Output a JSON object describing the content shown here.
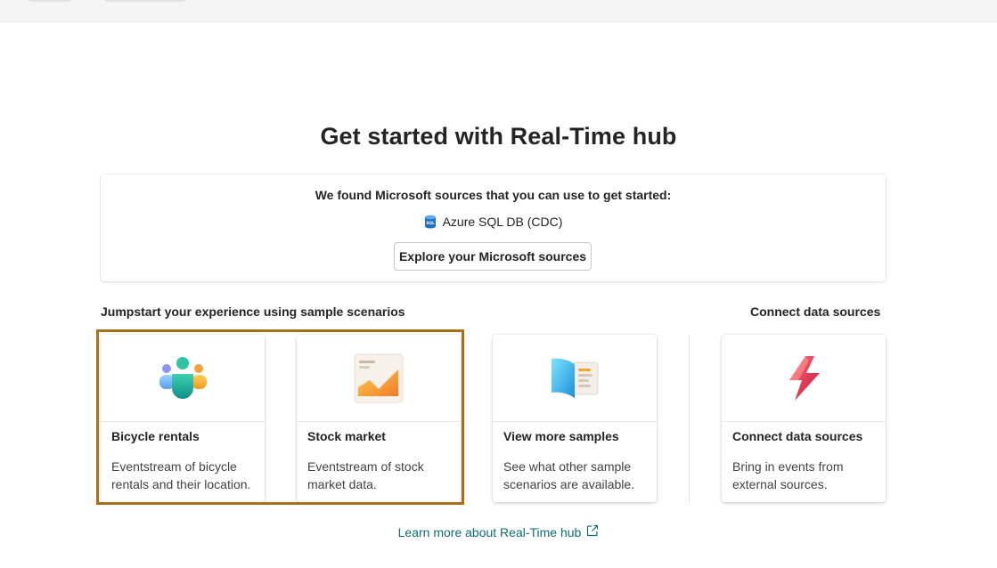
{
  "page": {
    "title": "Get started with Real-Time hub"
  },
  "found_sources": {
    "heading": "We found Microsoft sources that you can use to get started:",
    "source_name": "Azure SQL DB (CDC)",
    "explore_button": "Explore your Microsoft sources"
  },
  "sections": {
    "samples_label": "Jumpstart your experience using sample scenarios",
    "connect_label": "Connect data sources"
  },
  "cards": [
    {
      "title": "Bicycle rentals",
      "description": "Eventstream of bicycle rentals and their location.",
      "icon": "people-group-icon"
    },
    {
      "title": "Stock market",
      "description": "Eventstream of stock market data.",
      "icon": "area-chart-icon"
    },
    {
      "title": "View more samples",
      "description": "See what other sample scenarios are available.",
      "icon": "open-book-icon"
    },
    {
      "title": "Connect data sources",
      "description": "Bring in events from external sources.",
      "icon": "lightning-bolt-icon"
    }
  ],
  "footer": {
    "learn_more": "Learn more about Real-Time hub"
  },
  "colors": {
    "highlight_border": "#a96f1c",
    "link": "#0f6e74"
  }
}
